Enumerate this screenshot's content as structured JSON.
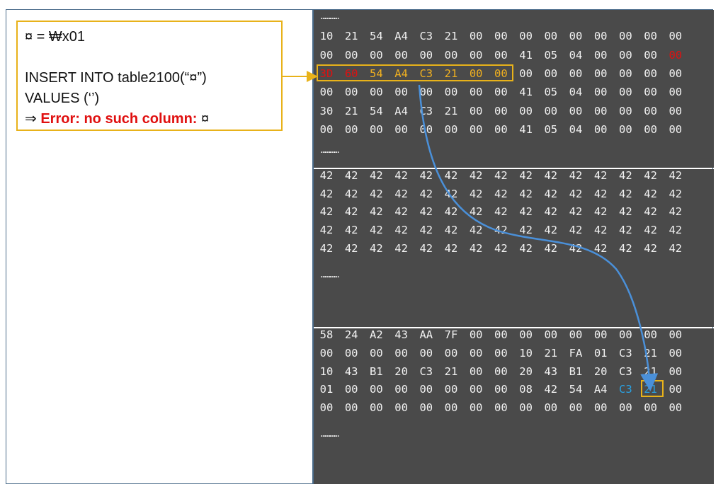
{
  "callout": {
    "line1": "¤ = ₩x01",
    "line2": "",
    "line3": "INSERT INTO table2100(“¤”)",
    "line4": "VALUES (‘’)",
    "line5_arrow": "⇒ ",
    "line5_error": "Error: no such column:",
    "line5_tail": " ¤"
  },
  "colors": {
    "highlight": "#e8b21a",
    "error": "#e01010",
    "arrow": "#4a90d9",
    "cyan": "#2aa0e0",
    "panel": "#4a4a4a"
  },
  "ellipsis": "…………",
  "panels": [
    {
      "rows": [
        [
          "10",
          "21",
          "54",
          "A4",
          "C3",
          "21",
          "00",
          "00",
          "00",
          "00",
          "00",
          "00",
          "00",
          "00",
          "00"
        ],
        [
          "00",
          "00",
          "00",
          "00",
          "00",
          "00",
          "00",
          "00",
          "41",
          "05",
          "04",
          "00",
          "00",
          "00",
          "00"
        ],
        [
          "3D",
          "60",
          "54",
          "A4",
          "C3",
          "21",
          "00",
          "00",
          "00",
          "00",
          "00",
          "00",
          "00",
          "00",
          "00"
        ],
        [
          "00",
          "00",
          "00",
          "00",
          "00",
          "00",
          "00",
          "00",
          "41",
          "05",
          "04",
          "00",
          "00",
          "00",
          "00"
        ],
        [
          "30",
          "21",
          "54",
          "A4",
          "C3",
          "21",
          "00",
          "00",
          "00",
          "00",
          "00",
          "00",
          "00",
          "00",
          "00"
        ],
        [
          "00",
          "00",
          "00",
          "00",
          "00",
          "00",
          "00",
          "00",
          "41",
          "05",
          "04",
          "00",
          "00",
          "00",
          "00"
        ]
      ],
      "styles": {
        "1-14": "red",
        "2-0": "red",
        "2-1": "red",
        "2-2": "gold",
        "2-3": "gold",
        "2-4": "gold",
        "2-5": "gold",
        "2-6": "gold",
        "2-7": "gold"
      }
    },
    {
      "rows": [
        [
          "42",
          "42",
          "42",
          "42",
          "42",
          "42",
          "42",
          "42",
          "42",
          "42",
          "42",
          "42",
          "42",
          "42",
          "42"
        ],
        [
          "42",
          "42",
          "42",
          "42",
          "42",
          "42",
          "42",
          "42",
          "42",
          "42",
          "42",
          "42",
          "42",
          "42",
          "42"
        ],
        [
          "42",
          "42",
          "42",
          "42",
          "42",
          "42",
          "42",
          "42",
          "42",
          "42",
          "42",
          "42",
          "42",
          "42",
          "42"
        ],
        [
          "42",
          "42",
          "42",
          "42",
          "42",
          "42",
          "42",
          "42",
          "42",
          "42",
          "42",
          "42",
          "42",
          "42",
          "42"
        ],
        [
          "42",
          "42",
          "42",
          "42",
          "42",
          "42",
          "42",
          "42",
          "42",
          "42",
          "42",
          "42",
          "42",
          "42",
          "42"
        ]
      ],
      "styles": {}
    },
    {
      "rows": [
        [
          "58",
          "24",
          "A2",
          "43",
          "AA",
          "7F",
          "00",
          "00",
          "00",
          "00",
          "00",
          "00",
          "00",
          "00",
          "00"
        ],
        [
          "00",
          "00",
          "00",
          "00",
          "00",
          "00",
          "00",
          "00",
          "10",
          "21",
          "FA",
          "01",
          "C3",
          "21",
          "00"
        ],
        [
          "10",
          "43",
          "B1",
          "20",
          "C3",
          "21",
          "00",
          "00",
          "20",
          "43",
          "B1",
          "20",
          "C3",
          "21",
          "00"
        ],
        [
          "01",
          "00",
          "00",
          "00",
          "00",
          "00",
          "00",
          "00",
          "08",
          "42",
          "54",
          "A4",
          "C3",
          "21",
          "00"
        ],
        [
          "00",
          "00",
          "00",
          "00",
          "00",
          "00",
          "00",
          "00",
          "00",
          "00",
          "00",
          "00",
          "00",
          "00",
          "00"
        ]
      ],
      "styles": {
        "3-12": "blue",
        "3-13": "blue"
      }
    }
  ]
}
